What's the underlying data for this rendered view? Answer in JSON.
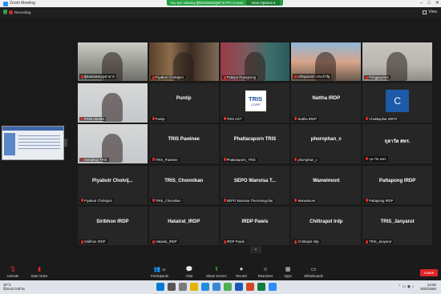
{
  "window": {
    "title": "Zoom Meeting",
    "min": "–",
    "max": "□",
    "close": "✕"
  },
  "share_bar": {
    "text": "You are viewing ผู้ชมพนพอนรูเตามาร's screen",
    "view_options": "View Options ▾"
  },
  "meeting": {
    "recording": "Recording",
    "view": "View"
  },
  "tiles": [
    {
      "type": "video",
      "style": "v1",
      "label": "ผู้ชมพนพอนรูเตามาร",
      "active": true
    },
    {
      "type": "video",
      "style": "v2",
      "label": "Piyabutr Cholvijarn"
    },
    {
      "type": "video",
      "style": "v3",
      "label": "Pattapa Ruangrong"
    },
    {
      "type": "video",
      "style": "v4",
      "label": "เจริญมนรยา ประจำรัฐ"
    },
    {
      "type": "video",
      "style": "v5",
      "label": "Pongpaysma"
    },
    {
      "type": "video",
      "style": "v6",
      "label": "Pichit Akrathit"
    },
    {
      "type": "name",
      "name": "Puntip",
      "label": "Puntip"
    },
    {
      "type": "logo",
      "logo": "tris",
      "label": "TRIS AGT"
    },
    {
      "type": "name",
      "name": "Nattha IRDP",
      "label": "Nattha IRDP"
    },
    {
      "type": "logo",
      "logo": "c",
      "label": "Chakkaphat SEPO"
    },
    {
      "type": "video",
      "style": "v6",
      "label": "Somphop TRIS"
    },
    {
      "type": "name",
      "name": "TRIS Pawinee",
      "label": "TRIS_Pawinee"
    },
    {
      "type": "name",
      "name": "Phattaraporn TRIS",
      "label": "Phattaraporn_TRIS"
    },
    {
      "type": "name",
      "name": "phornphan_c",
      "label": "phornphan_c"
    },
    {
      "type": "name",
      "name": "กุลาวัล สทร.",
      "label": "กุลาวัล สทร."
    },
    {
      "type": "name",
      "name": "Piyabutr Cholvij...",
      "label": "Piyabutr Cholvijarn"
    },
    {
      "type": "name",
      "name": "TRIS_Chonnikan",
      "label": "TRIS_Chonnikan"
    },
    {
      "type": "name",
      "name": "SEPO Wanvisa T...",
      "label": "SEPO Wanvisa Thermtongchai"
    },
    {
      "type": "name",
      "name": "Wanwimont",
      "label": "Wanwimont"
    },
    {
      "type": "name",
      "name": "Pattapong IRDP",
      "label": "Pattapong IRDP"
    },
    {
      "type": "name",
      "name": "Siribhon IRDP",
      "label": "Siribhon IRDP"
    },
    {
      "type": "name",
      "name": "Hatairat_IRDP",
      "label": "Hatairat_IRDP"
    },
    {
      "type": "name",
      "name": "IRDP Pawis",
      "label": "IRDP Pawis"
    },
    {
      "type": "name",
      "name": "Chittrapol Irdp",
      "label": "Chittrapol Irdp"
    },
    {
      "type": "name",
      "name": "TRIS_Janyarut",
      "label": "TRIS_Janyarut"
    }
  ],
  "logos": {
    "tris_main": "TRIS",
    "tris_sub": "CORP",
    "c": "C"
  },
  "toolbar": {
    "unmute": "Unmute",
    "start_video": "Start Video",
    "participants": "Participants",
    "participants_count": "30",
    "chat": "Chat",
    "share_screen": "Share Screen",
    "record": "Record",
    "reactions": "Reactions",
    "apps": "Apps",
    "whiteboards": "Whiteboards",
    "leave": "Leave"
  },
  "taskbar": {
    "temp": "30°C",
    "weather": "มีเมฆบางส่วน",
    "time": "13:55",
    "date": "30/8/2565"
  },
  "colors": {
    "accent": "#2d8cff",
    "leave": "#e0242b",
    "share_green": "#25a142",
    "active_border": "#9acd32"
  }
}
